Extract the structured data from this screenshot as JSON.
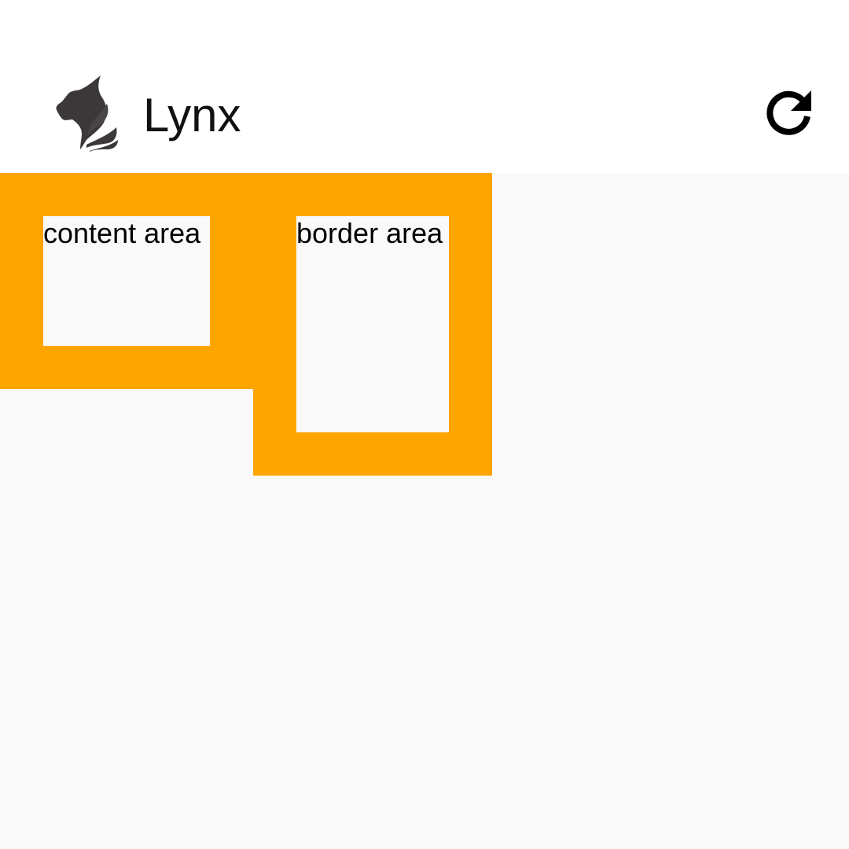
{
  "app_bar": {
    "logo_icon": "lynx-logo-icon",
    "title": "Lynx",
    "refresh_icon": "refresh-icon"
  },
  "boxes": [
    {
      "label": "content area",
      "color": "#ffa500"
    },
    {
      "label": "border area",
      "color": "#ffa500"
    }
  ],
  "colors": {
    "accent": "#ffa500",
    "background": "#f9f9f9",
    "app_bar": "#ffffff"
  }
}
